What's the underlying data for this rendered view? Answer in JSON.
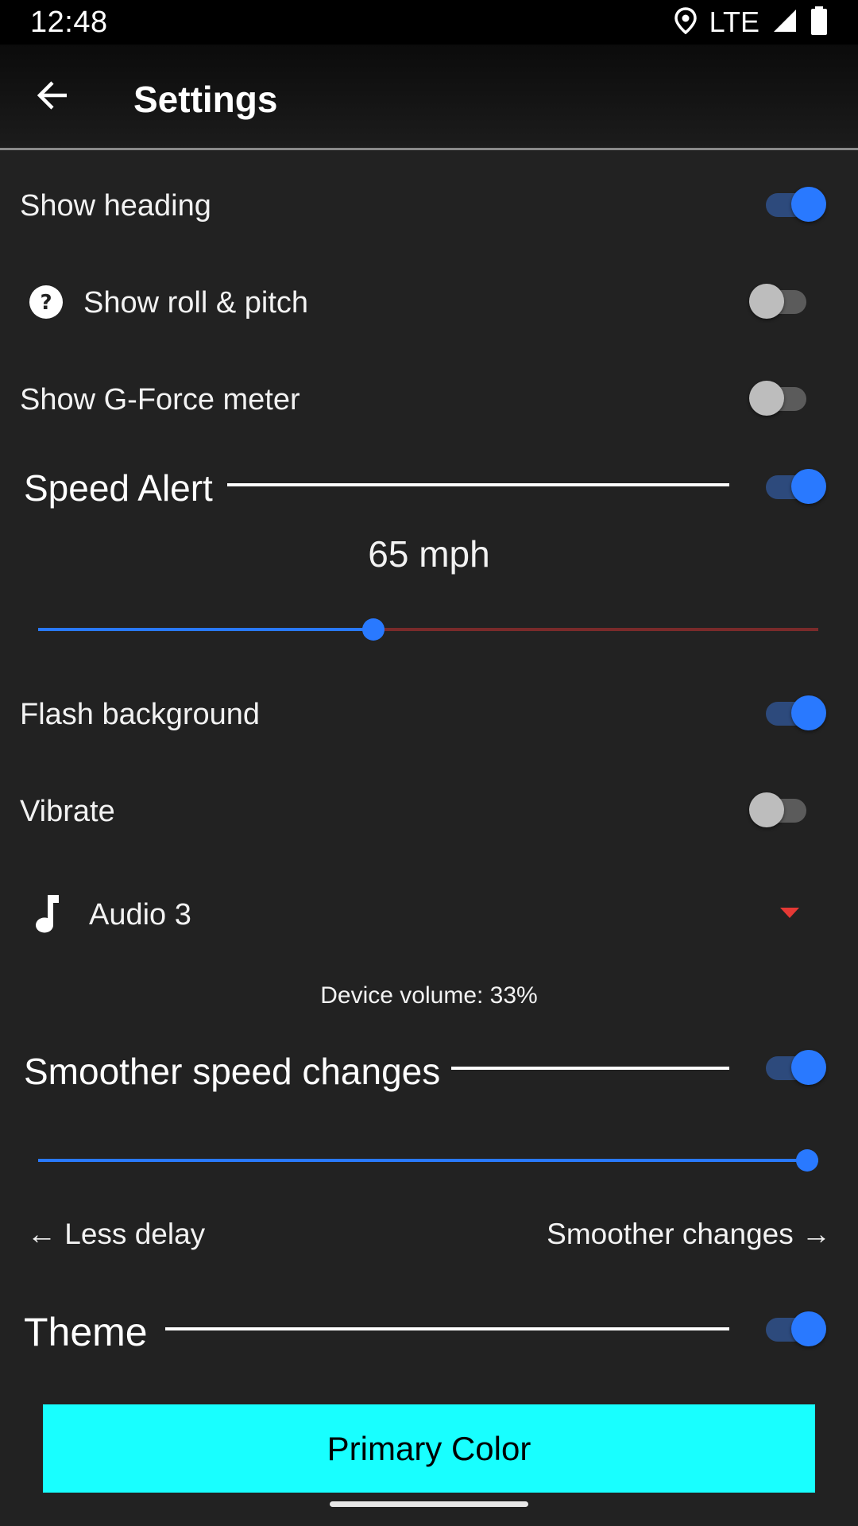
{
  "status_bar": {
    "time": "12:48",
    "network": "LTE"
  },
  "app_bar": {
    "title": "Settings"
  },
  "settings": {
    "show_heading": {
      "label": "Show heading",
      "enabled": true
    },
    "show_roll_pitch": {
      "label": "Show roll & pitch",
      "enabled": false
    },
    "show_gforce": {
      "label": "Show G-Force meter",
      "enabled": false
    },
    "speed_alert": {
      "title": "Speed Alert",
      "enabled": true,
      "value_text": "65 mph",
      "slider_fraction": 0.43
    },
    "flash_background": {
      "label": "Flash background",
      "enabled": true
    },
    "vibrate": {
      "label": "Vibrate",
      "enabled": false
    },
    "audio": {
      "selected": "Audio 3"
    },
    "device_volume": "Device volume: 33%",
    "smoother_speed": {
      "title": "Smoother speed changes",
      "enabled": true,
      "slider_fraction": 1.0,
      "left_label": "← Less delay",
      "right_label": "Smoother changes →"
    },
    "theme": {
      "title": "Theme",
      "enabled": true
    }
  },
  "primary_button": {
    "label": "Primary Color"
  },
  "colors": {
    "background": "#222222",
    "accent": "#2979ff",
    "slider_inactive": "#7a2a2a",
    "dropdown_arrow": "#e53935",
    "primary_button": "#18ffff"
  },
  "icons": {
    "back": "arrow-left-icon",
    "help": "help-circle-icon",
    "music": "music-note-icon",
    "location": "location-pin-icon",
    "signal": "signal-icon",
    "battery": "battery-icon"
  }
}
